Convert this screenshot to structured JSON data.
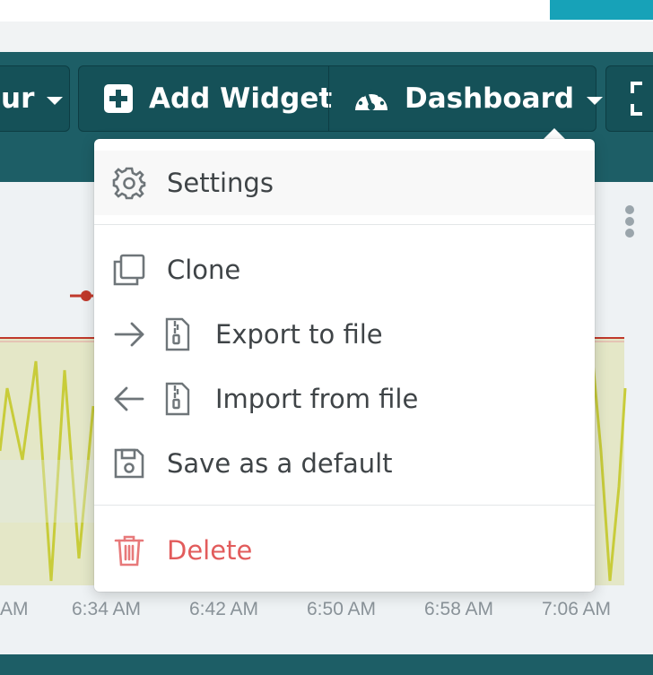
{
  "toolbar": {
    "left_fragment": "ur",
    "add_widget_label": "Add Widget",
    "dashboard_label": "Dashboard"
  },
  "menu": {
    "items": [
      {
        "label": "Settings",
        "icon": "gear-icon"
      },
      {
        "label": "Clone",
        "icon": "clone-icon"
      },
      {
        "label": "Export to file",
        "icon": "arrow-right-icon"
      },
      {
        "label": "Import from file",
        "icon": "arrow-left-icon"
      },
      {
        "label": "Save as a default",
        "icon": "floppy-disk-icon"
      },
      {
        "label": "Delete",
        "icon": "trash-icon"
      }
    ]
  },
  "chart": {
    "x_ticks": [
      "AM",
      "6:34 AM",
      "6:42 AM",
      "6:50 AM",
      "6:58 AM",
      "7:06 AM"
    ]
  },
  "colors": {
    "toolbar": "#1d5e66",
    "button": "#155158",
    "accent": "#17a2b8",
    "series": "#c8cc3a",
    "threshold": "#c0392b",
    "danger": "#e25c5c"
  }
}
